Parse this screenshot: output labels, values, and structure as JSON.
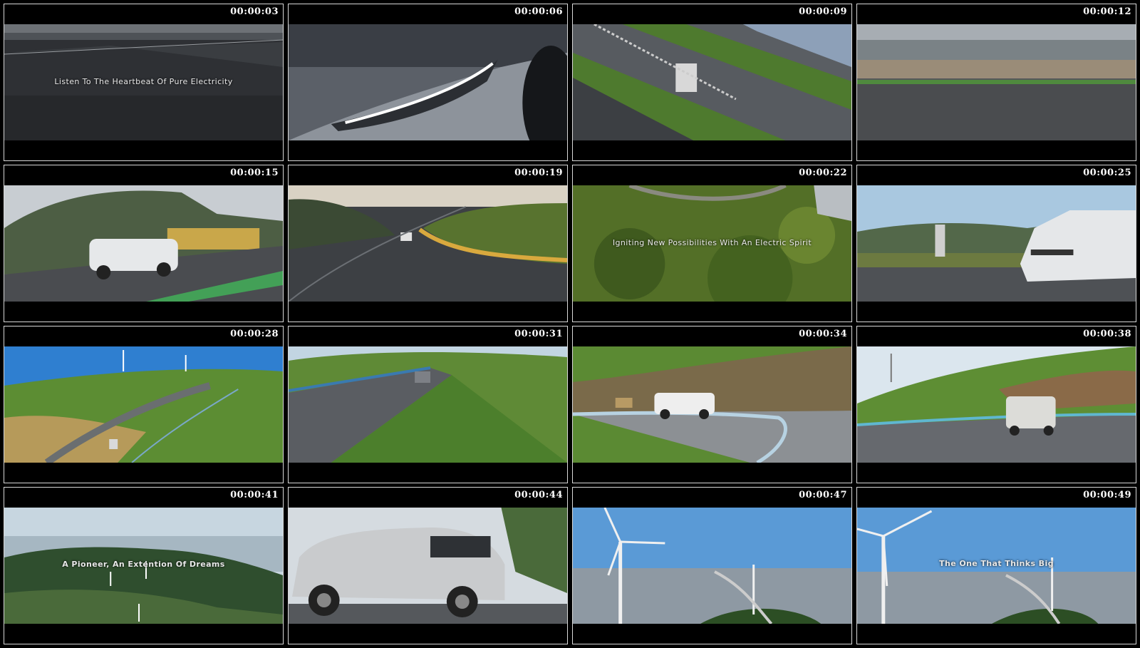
{
  "tiles": [
    {
      "time": "00:00:03",
      "caption": "Listen To The Heartbeat Of Pure Electricity",
      "scene": "race-track-asphalt"
    },
    {
      "time": "00:00:06",
      "caption": "",
      "scene": "headlight-closeup"
    },
    {
      "time": "00:00:09",
      "caption": "",
      "scene": "track-aerial"
    },
    {
      "time": "00:00:12",
      "caption": "",
      "scene": "motion-blur-track"
    },
    {
      "time": "00:00:15",
      "caption": "",
      "scene": "suv-on-track"
    },
    {
      "time": "00:00:19",
      "caption": "",
      "scene": "track-curve"
    },
    {
      "time": "00:00:22",
      "caption": "Igniting New Possibilities With An Electric Spirit",
      "scene": "forest-aerial"
    },
    {
      "time": "00:00:25",
      "caption": "",
      "scene": "suv-front-track"
    },
    {
      "time": "00:00:28",
      "caption": "",
      "scene": "mountain-road-turbines"
    },
    {
      "time": "00:00:31",
      "caption": "",
      "scene": "mountain-road"
    },
    {
      "time": "00:00:34",
      "caption": "",
      "scene": "guardrail-road"
    },
    {
      "time": "00:00:38",
      "caption": "",
      "scene": "suv-rear-hill"
    },
    {
      "time": "00:00:41",
      "caption": "A Pioneer,  An Extention Of Dreams",
      "scene": "wind-farm-hills"
    },
    {
      "time": "00:00:44",
      "caption": "",
      "scene": "suv-side-road"
    },
    {
      "time": "00:00:47",
      "caption": "",
      "scene": "wind-turbine-coast"
    },
    {
      "time": "00:00:49",
      "caption": "The One That Thinks Big",
      "scene": "wind-turbine-coast-2"
    }
  ]
}
